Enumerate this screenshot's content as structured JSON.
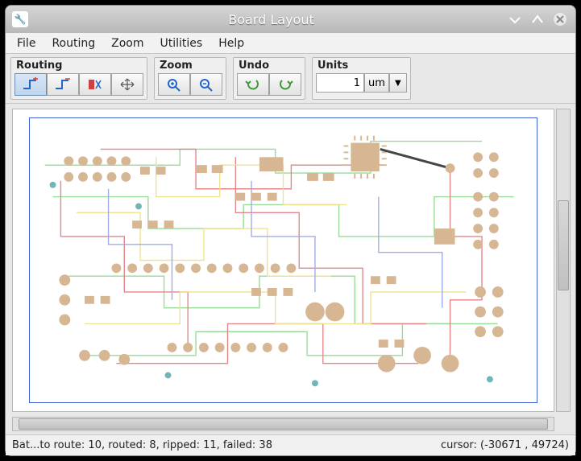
{
  "window": {
    "title": "Board Layout"
  },
  "menubar": {
    "items": [
      {
        "label": "File",
        "ul": 0
      },
      {
        "label": "Routing",
        "ul": 0
      },
      {
        "label": "Zoom",
        "ul": 0
      },
      {
        "label": "Utilities",
        "ul": 0
      },
      {
        "label": "Help",
        "ul": 0
      }
    ]
  },
  "toolgroups": {
    "routing": {
      "label": "Routing"
    },
    "zoom": {
      "label": "Zoom"
    },
    "undo": {
      "label": "Undo"
    },
    "units": {
      "label": "Units",
      "value": "1",
      "unit": "um"
    }
  },
  "status": {
    "left": "Bat...to route: 10, routed: 8,     ripped: 11, failed: 38",
    "right": "cursor: (-30671 , 49724)"
  },
  "colors": {
    "pad": "#c89a6a",
    "trace_red": "#d65a5a",
    "trace_green": "#6ecf6e",
    "trace_yellow": "#e8d86a",
    "trace_blue": "#7a8de0",
    "via_teal": "#3a9a9a",
    "outline": "#3b5fd6"
  }
}
